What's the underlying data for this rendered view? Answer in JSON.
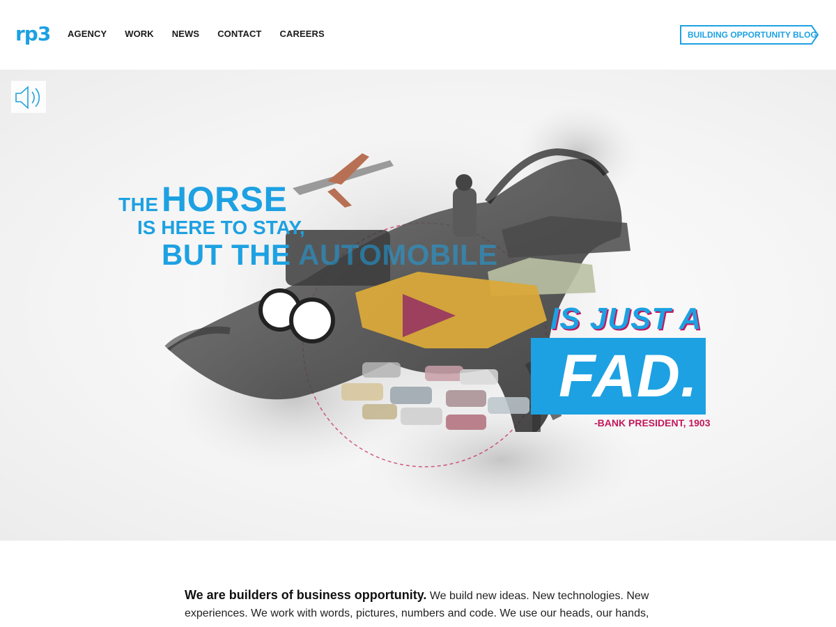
{
  "header": {
    "logo": "rp3",
    "nav": [
      "AGENCY",
      "WORK",
      "NEWS",
      "CONTACT",
      "CAREERS"
    ],
    "blog_button": "BUILDING OPPORTUNITY BLOG"
  },
  "hero": {
    "quote_the": "THE",
    "quote_horse": "HORSE",
    "quote_stay": "IS HERE TO STAY,",
    "quote_but_the": "BUT THE",
    "quote_automobile": "AUTOMOBILE",
    "quote_just_a": "IS JUST A",
    "quote_fad": "FAD.",
    "attribution": "-BANK PRESIDENT, 1903",
    "sound_icon": "speaker-icon",
    "play_icon": "play-icon"
  },
  "intro": {
    "lead": "We are builders of business opportunity.",
    "body": " We build new ideas. New technologies. New experiences. We work with words, pictures, numbers and code. We use our heads, our hands,"
  },
  "colors": {
    "accent": "#1da1e2",
    "magenta": "#c2185b"
  }
}
